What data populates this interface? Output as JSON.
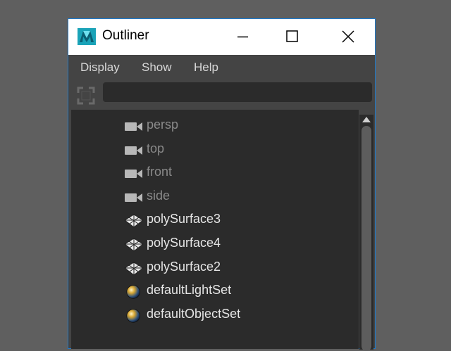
{
  "window": {
    "title": "Outliner",
    "accent_color": "#1f78c8",
    "app_icon": "maya-logo-icon"
  },
  "menu": {
    "items": [
      {
        "label": "Display"
      },
      {
        "label": "Show"
      },
      {
        "label": "Help"
      }
    ]
  },
  "filter": {
    "icon": "filter-icon",
    "value": "",
    "placeholder": ""
  },
  "outliner": {
    "items": [
      {
        "label": "persp",
        "type": "camera",
        "icon": "camera-icon"
      },
      {
        "label": "top",
        "type": "camera",
        "icon": "camera-icon"
      },
      {
        "label": "front",
        "type": "camera",
        "icon": "camera-icon"
      },
      {
        "label": "side",
        "type": "camera",
        "icon": "camera-icon"
      },
      {
        "label": "polySurface3",
        "type": "mesh",
        "icon": "mesh-icon"
      },
      {
        "label": "polySurface4",
        "type": "mesh",
        "icon": "mesh-icon"
      },
      {
        "label": "polySurface2",
        "type": "mesh",
        "icon": "mesh-icon"
      },
      {
        "label": "defaultLightSet",
        "type": "set",
        "icon": "set-sphere-icon"
      },
      {
        "label": "defaultObjectSet",
        "type": "set",
        "icon": "set-sphere-icon"
      }
    ]
  }
}
